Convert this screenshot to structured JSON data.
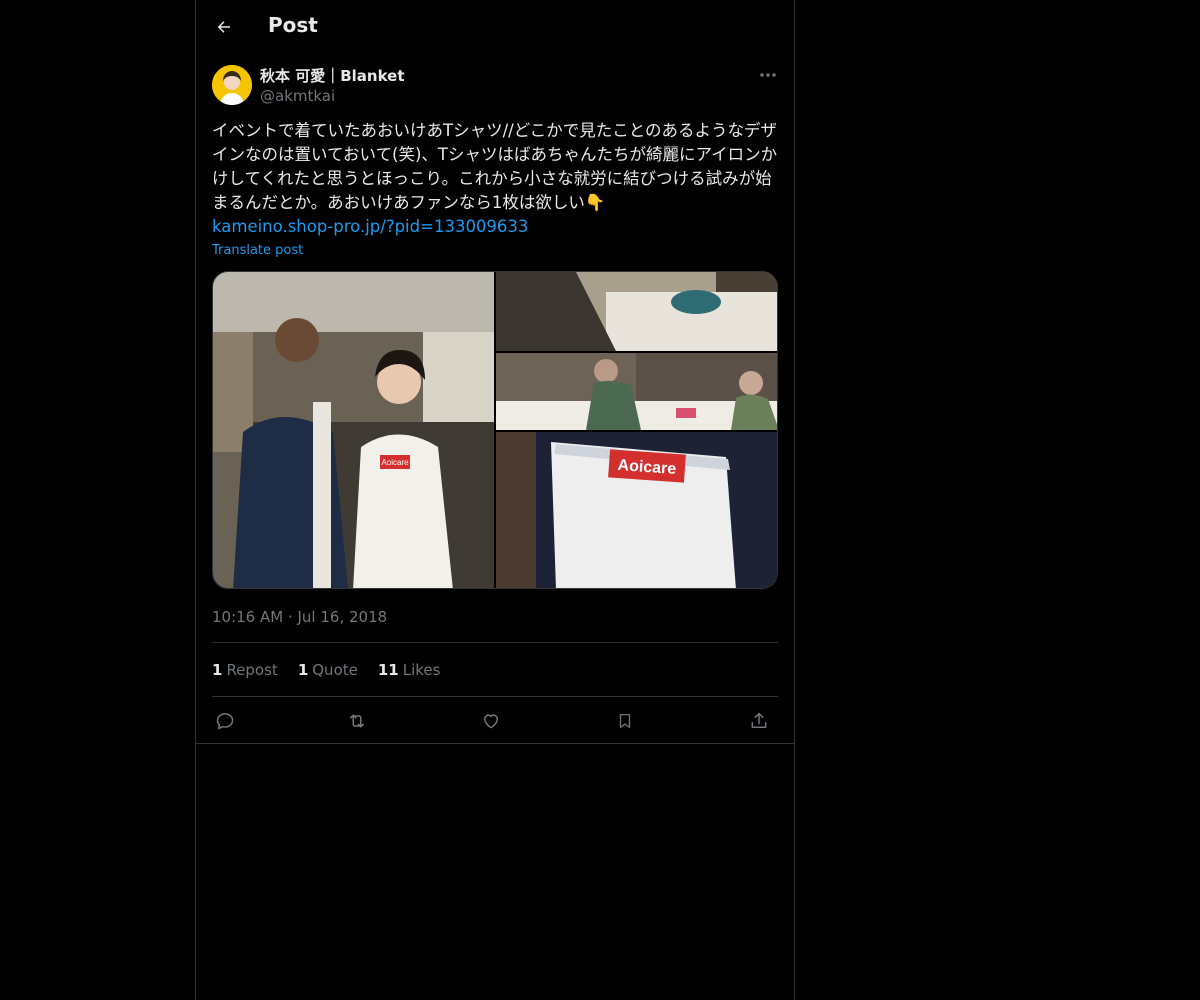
{
  "header": {
    "title": "Post"
  },
  "author": {
    "display_name": "秋本 可愛｜Blanket",
    "handle": "@akmtkai"
  },
  "tweet": {
    "text": "イベントで着ていたあおいけあTシャツ//どこかで見たことのあるようなデザインなのは置いておいて(笑)、Tシャツはばあちゃんたちが綺麗にアイロンかけしてくれたと思うとほっこり。これから小さな就労に結びつける試みが始まるんだとか。あおいけあファンなら1枚は欲しい👇",
    "link": "kameino.shop-pro.jp/?pid=133009633",
    "translate_label": "Translate post",
    "media_labels": {
      "tshirt_logo_1": "Aoicare",
      "tshirt_logo_2": "Aoicare"
    }
  },
  "meta": {
    "timestamp": "10:16 AM · Jul 16, 2018"
  },
  "stats": {
    "reposts_count": "1",
    "reposts_label": "Repost",
    "quotes_count": "1",
    "quotes_label": "Quote",
    "likes_count": "11",
    "likes_label": "Likes"
  },
  "icons": {
    "back": "arrow-left-icon",
    "more": "more-horizontal-icon",
    "reply": "reply-icon",
    "repost": "repost-icon",
    "like": "heart-icon",
    "bookmark": "bookmark-icon",
    "share": "share-icon"
  },
  "colors": {
    "background": "#000000",
    "text": "#e7e9ea",
    "muted": "#71767b",
    "link": "#1d9bf0",
    "border": "#2f3336",
    "logo_red": "#d32f2f"
  }
}
